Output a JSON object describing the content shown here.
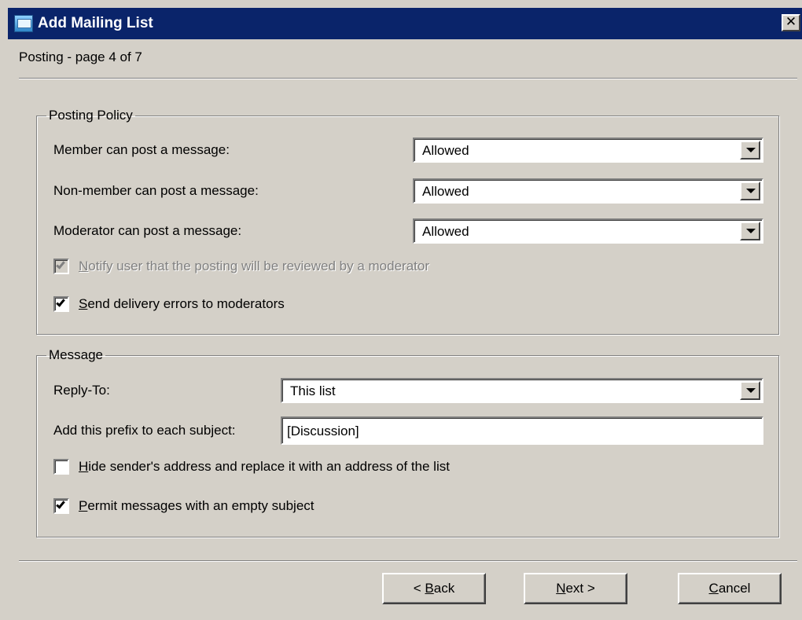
{
  "window": {
    "title": "Add Mailing List",
    "close_glyph": "✕",
    "icon": "mailing-list-icon"
  },
  "header": {
    "page_title": "Posting - page 4 of 7"
  },
  "posting_policy": {
    "legend": "Posting Policy",
    "member_label": "Member can post a message:",
    "member_value": "Allowed",
    "nonmember_label": "Non-member can post a message:",
    "nonmember_value": "Allowed",
    "moderator_label": "Moderator can post a message:",
    "moderator_value": "Allowed",
    "notify": {
      "mnemonic": "N",
      "rest": "otify user that the posting will be reviewed by a moderator",
      "checked": true,
      "enabled": false
    },
    "send_errors": {
      "mnemonic": "S",
      "rest": "end delivery errors to moderators",
      "checked": true,
      "enabled": true
    }
  },
  "message": {
    "legend": "Message",
    "reply_to_label": "Reply-To:",
    "reply_to_value": "This list",
    "prefix_label": "Add this prefix to each subject:",
    "prefix_value": "[Discussion]",
    "hide_sender": {
      "mnemonic": "H",
      "rest": "ide sender's address and replace it with an address of the list",
      "checked": false,
      "enabled": true
    },
    "permit_empty": {
      "mnemonic": "P",
      "rest": "ermit messages with an empty subject",
      "checked": true,
      "enabled": true
    }
  },
  "footer": {
    "back": {
      "prefix": "< ",
      "mnemonic": "B",
      "rest": "ack"
    },
    "next": {
      "mnemonic": "N",
      "rest": "ext >"
    },
    "cancel": {
      "mnemonic": "C",
      "rest": "ancel"
    }
  }
}
